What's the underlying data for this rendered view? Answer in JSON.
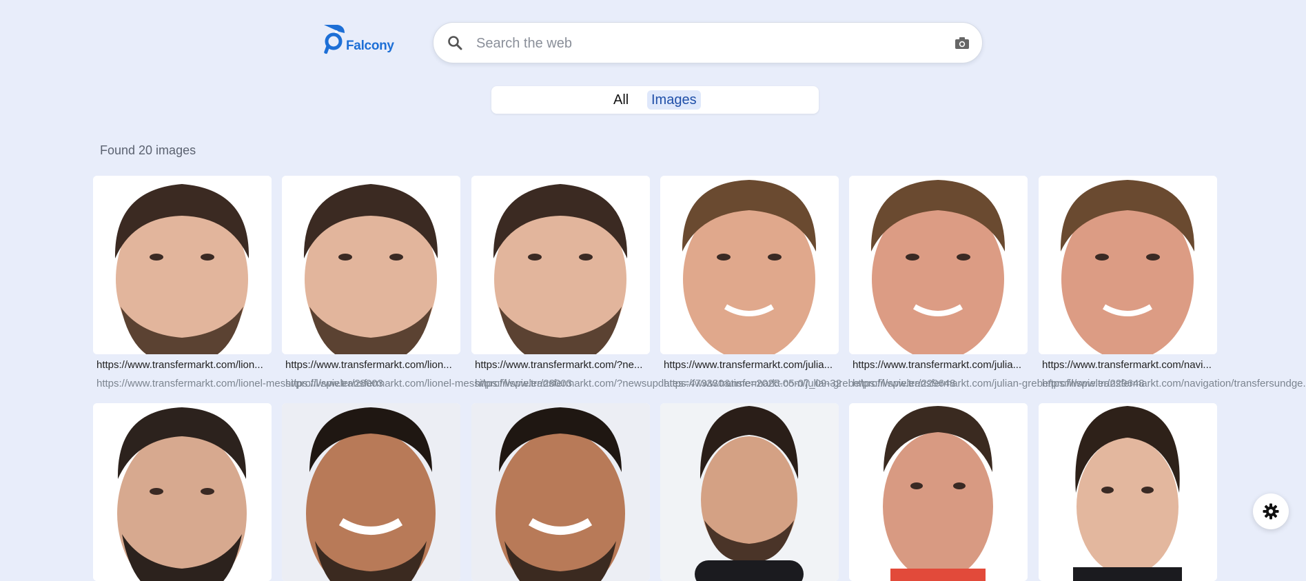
{
  "logo": {
    "text": "Falcony"
  },
  "search": {
    "placeholder": "Search the web",
    "value": ""
  },
  "tabs": [
    {
      "label": "All"
    },
    {
      "label": "Images"
    }
  ],
  "results_summary": "Found 20 images",
  "results": [
    {
      "title": "https://www.transfermarkt.com/lion...",
      "url": "https://www.transfermarkt.com/lionel-messi/profil/spieler/28003"
    },
    {
      "title": "https://www.transfermarkt.com/lion...",
      "url": "https://www.transfermarkt.com/lionel-messi/profil/spieler/28003"
    },
    {
      "title": "https://www.transfermarkt.com/?ne...",
      "url": "https://www.transfermarkt.com/?newsupdates=473330&time=2025-05-07_09-32"
    },
    {
      "title": "https://www.transfermarkt.com/julia...",
      "url": "https://www.transfermarkt.com/julian-grebe/profil/spieler/229648"
    },
    {
      "title": "https://www.transfermarkt.com/julia...",
      "url": "https://www.transfermarkt.com/julian-grebe/profil/spieler/229648"
    },
    {
      "title": "https://www.transfermarkt.com/navi...",
      "url": "https://www.transfermarkt.com/navigation/transfersundge..."
    },
    {
      "title": "",
      "url": ""
    },
    {
      "title": "",
      "url": ""
    },
    {
      "title": "",
      "url": ""
    },
    {
      "title": "",
      "url": ""
    },
    {
      "title": "",
      "url": ""
    },
    {
      "title": "",
      "url": ""
    }
  ],
  "icons": {
    "logo": "falcon-logo-icon",
    "search": "search-icon",
    "camera": "camera-icon",
    "settings": "gear-icon"
  },
  "colors": {
    "background": "#e8edfa",
    "accent": "#1d6fd6",
    "tab_active_bg": "#dfe8fb"
  }
}
